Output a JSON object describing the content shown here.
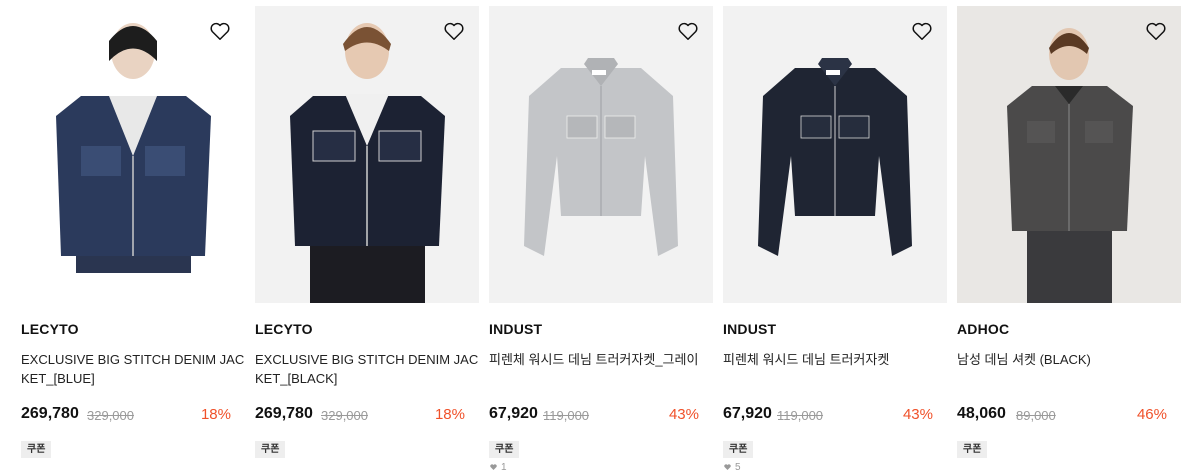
{
  "products": [
    {
      "brand": "LECYTO",
      "title": "EXCLUSIVE BIG STITCH DENIM JACKET_[BLUE]",
      "price": "269,780",
      "original_price": "329,000",
      "discount": "18%",
      "coupon": "쿠폰",
      "likes": null,
      "bg": "#ffffff",
      "garment": "dark-blue-denim-model"
    },
    {
      "brand": "LECYTO",
      "title": "EXCLUSIVE BIG STITCH DENIM JACKET_[BLACK]",
      "price": "269,780",
      "original_price": "329,000",
      "discount": "18%",
      "coupon": "쿠폰",
      "likes": null,
      "bg": "#f2f2f2",
      "garment": "black-denim-model"
    },
    {
      "brand": "INDUST",
      "title": "피렌체 워시드 데님 트러커자켓_그레이",
      "price": "67,920",
      "original_price": "119,000",
      "discount": "43%",
      "coupon": "쿠폰",
      "likes": "1",
      "bg": "#f2f2f2",
      "garment": "grey-trucker-jacket"
    },
    {
      "brand": "INDUST",
      "title": "피렌체 워시드 데님 트러커자켓",
      "price": "67,920",
      "original_price": "119,000",
      "discount": "43%",
      "coupon": "쿠폰",
      "likes": "5",
      "bg": "#f2f2f2",
      "garment": "navy-trucker-jacket"
    },
    {
      "brand": "ADHOC",
      "title": "남성 데님 셔켓 (BLACK)",
      "price": "48,060",
      "original_price": "89,000",
      "discount": "46%",
      "coupon": "쿠폰",
      "likes": null,
      "bg": "#e9e7e4",
      "garment": "charcoal-denim-shirt-model"
    }
  ],
  "colors": {
    "discount": "#f0512a",
    "strike": "#9a9a9a",
    "coupon_bg": "#eeeeee"
  },
  "icons": {
    "wishlist": "heart-outline-icon",
    "likes": "heart-filled-icon"
  }
}
